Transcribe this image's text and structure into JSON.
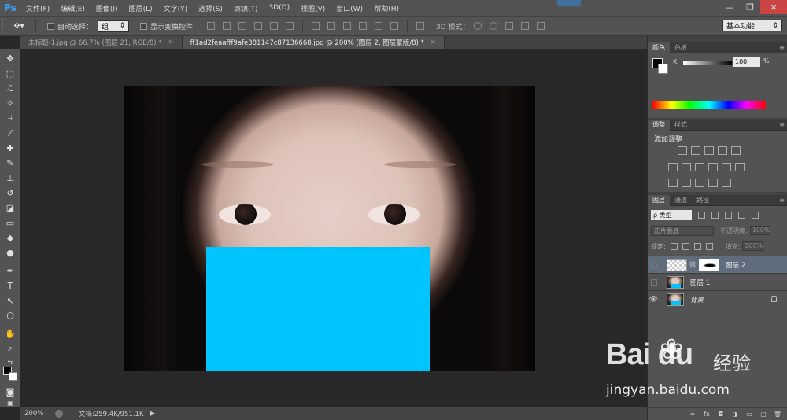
{
  "app": {
    "logo": "Ps"
  },
  "menubar": {
    "items": [
      "文件(F)",
      "编辑(E)",
      "图像(I)",
      "图层(L)",
      "文字(Y)",
      "选择(S)",
      "滤镜(T)",
      "3D(D)",
      "视图(V)",
      "窗口(W)",
      "帮助(H)"
    ],
    "window_controls": [
      "—",
      "❐",
      "✕"
    ]
  },
  "optionsbar": {
    "auto_select_label": "自动选择：",
    "auto_select_value": "组",
    "show_transform_label": "显示变换控件",
    "mode_3d_label": "3D 模式：",
    "workspace": "基本功能"
  },
  "tabs": [
    {
      "label": "未标题-1.jpg @ 66.7% (图层 21, RGB/8) *",
      "active": false
    },
    {
      "label": "ff1ad2feaafff9afe381147c87136668.jpg @ 200% (图层 2, 图层蒙版/8) *",
      "active": true
    }
  ],
  "status": {
    "zoom": "200%",
    "doc_info": "文档:259.4K/951.1K"
  },
  "panels": {
    "color": {
      "tabs": [
        "颜色",
        "色板"
      ],
      "channel_label": "K",
      "value": "100",
      "unit": "%"
    },
    "adjustments": {
      "tabs": [
        "调整",
        "样式"
      ],
      "title": "添加调整"
    },
    "layers": {
      "tabs": [
        "图层",
        "通道",
        "路径"
      ],
      "filter_label": "ρ 类型",
      "blend_mode": "正片叠底",
      "opacity_label": "不透明度:",
      "opacity_value": "100%",
      "lock_label": "锁定:",
      "fill_label": "填充:",
      "fill_value": "100%",
      "items": [
        {
          "name": "图层 2",
          "visible": false,
          "selected": true
        },
        {
          "name": "图层 1",
          "visible": false,
          "selected": false
        },
        {
          "name": "背景",
          "visible": true,
          "selected": false,
          "locked": true
        }
      ],
      "footer_icons": [
        "link-icon",
        "fx-icon",
        "mask-icon",
        "adjustment-icon",
        "group-icon",
        "new-layer-icon",
        "trash-icon"
      ],
      "footer_glyphs": [
        "∞",
        "fx",
        "◘",
        "◑",
        "▭",
        "▢",
        "🗑"
      ]
    }
  },
  "colors": {
    "mask_fill": "#00c4fd",
    "ui_dark": "#535353",
    "canvas_bg": "#282828"
  },
  "watermark": {
    "logo": "Bai du",
    "paw": "❀",
    "cn": "经验",
    "url": "jingyan.baidu.com"
  }
}
